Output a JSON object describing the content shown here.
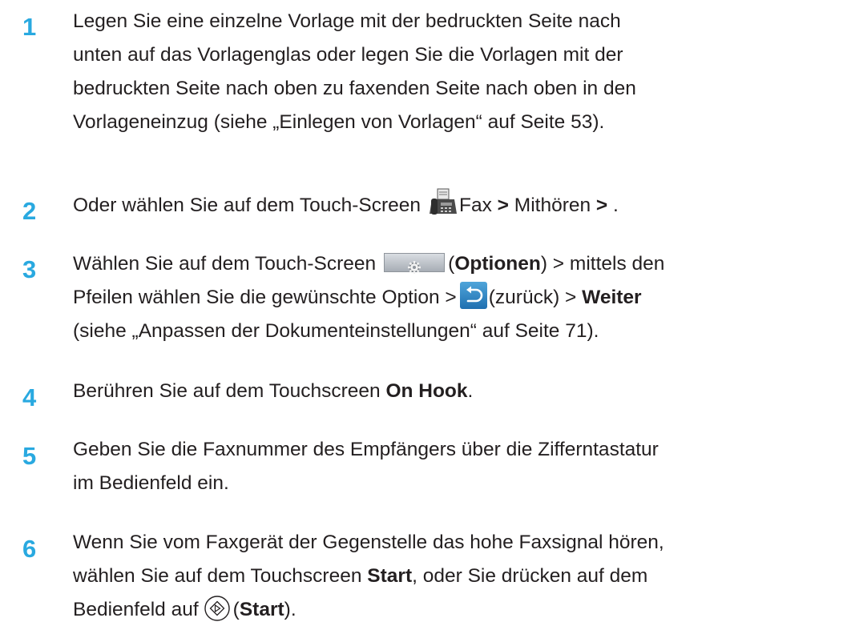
{
  "steps": [
    {
      "number": "1",
      "lines": [
        "Legen Sie eine einzelne Vorlage mit der bedruckten Seite nach",
        "unten auf das Vorlagenglas oder legen Sie die Vorlagen mit der",
        "bedruckten Seite nach oben zu faxenden Seite nach oben in den",
        "Vorlageneinzug (siehe „Einlegen von Vorlagen“ auf Seite 53)."
      ]
    },
    {
      "number": "2",
      "prefix": "Oder wählen Sie auf dem Touch-Screen",
      "fax": "Fax",
      "sep1": ">",
      "listen": "Mithören",
      "sep2": ">",
      "end": "."
    },
    {
      "number": "3",
      "l1_a": "Wählen Sie auf dem Touch-Screen",
      "l1_b": "(",
      "l1_options": "Optionen",
      "l1_c": ") > mittels den",
      "l2_a": "Pfeilen wählen Sie die gewünschte Option >",
      "l2_b": "(zurück) >",
      "l2_next": "Weiter",
      "l3": "(siehe „Anpassen der Dokumenteinstellungen“ auf Seite 71)."
    },
    {
      "number": "4",
      "a": "Berühren Sie auf dem Touchscreen",
      "onhook": "On Hook",
      "end": "."
    },
    {
      "number": "5",
      "lines": [
        "Geben Sie die Faxnummer des Empfängers über die Zifferntastatur",
        "im Bedienfeld ein."
      ]
    },
    {
      "number": "6",
      "l1": "Wenn Sie vom Faxgerät der Gegenstelle das hohe Faxsignal hören,",
      "l2_a": "wählen Sie auf dem Touchscreen",
      "l2_start": "Start",
      "l2_b": ", oder Sie drücken auf dem",
      "l3_a": "Bedienfeld auf",
      "l3_b": "(",
      "l3_start": "Start",
      "l3_c": ")."
    }
  ],
  "colors": {
    "step_number": "#29a9e0",
    "text": "#231f20"
  },
  "icons": [
    "fax-machine-icon",
    "options-gear-icon",
    "back-arrow-icon",
    "start-button-icon"
  ]
}
